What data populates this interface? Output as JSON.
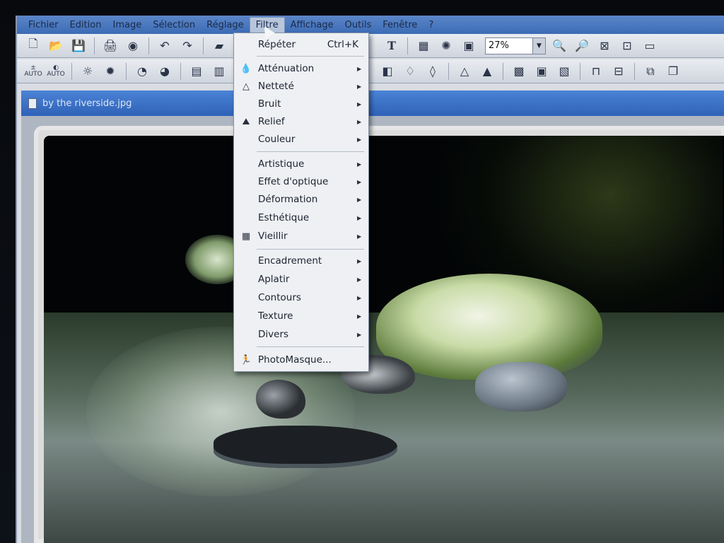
{
  "menubar": {
    "items": [
      "Fichier",
      "Edition",
      "Image",
      "Sélection",
      "Réglage",
      "Filtre",
      "Affichage",
      "Outils",
      "Fenêtre",
      "?"
    ],
    "open_index": 5
  },
  "toolbar": {
    "zoom_value": "27%",
    "text_tool": "T",
    "auto_label": "AUTO"
  },
  "document": {
    "title": "by the riverside.jpg"
  },
  "dropdown": {
    "items": [
      {
        "label": "Répéter",
        "shortcut": "Ctrl+K",
        "icon": "",
        "submenu": false
      },
      {
        "label": "Atténuation",
        "shortcut": "",
        "icon": "drop-icon",
        "submenu": true
      },
      {
        "label": "Netteté",
        "shortcut": "",
        "icon": "triangle-drop-icon",
        "submenu": true
      },
      {
        "label": "Bruit",
        "shortcut": "",
        "icon": "",
        "submenu": true
      },
      {
        "label": "Relief",
        "shortcut": "",
        "icon": "relief-icon",
        "submenu": true
      },
      {
        "label": "Couleur",
        "shortcut": "",
        "icon": "",
        "submenu": true
      },
      {
        "label": "Artistique",
        "shortcut": "",
        "icon": "",
        "submenu": true
      },
      {
        "label": "Effet d'optique",
        "shortcut": "",
        "icon": "",
        "submenu": true
      },
      {
        "label": "Déformation",
        "shortcut": "",
        "icon": "",
        "submenu": true
      },
      {
        "label": "Esthétique",
        "shortcut": "",
        "icon": "",
        "submenu": true
      },
      {
        "label": "Vieillir",
        "shortcut": "",
        "icon": "grid-icon",
        "submenu": true
      },
      {
        "label": "Encadrement",
        "shortcut": "",
        "icon": "",
        "submenu": true
      },
      {
        "label": "Aplatir",
        "shortcut": "",
        "icon": "",
        "submenu": true
      },
      {
        "label": "Contours",
        "shortcut": "",
        "icon": "",
        "submenu": true
      },
      {
        "label": "Texture",
        "shortcut": "",
        "icon": "",
        "submenu": true
      },
      {
        "label": "Divers",
        "shortcut": "",
        "icon": "",
        "submenu": true
      },
      {
        "label": "PhotoMasque...",
        "shortcut": "",
        "icon": "photomasque-icon",
        "submenu": false
      }
    ]
  },
  "colors": {
    "menubar_blue": "#3c6bb5",
    "doc_title_blue": "#2f62b8",
    "menu_bg": "#eef0f3"
  }
}
